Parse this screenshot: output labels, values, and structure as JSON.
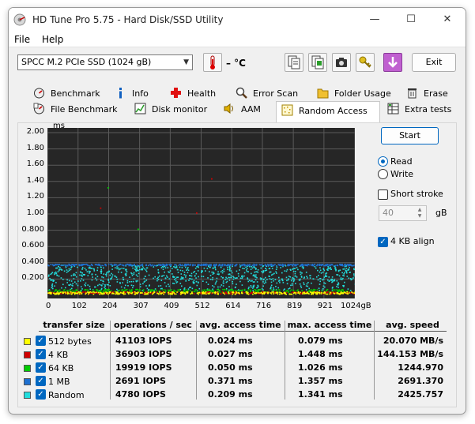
{
  "window": {
    "title": "HD Tune Pro 5.75 - Hard Disk/SSD Utility",
    "minimize": "—",
    "maximize": "☐",
    "close": "✕"
  },
  "menu": [
    "File",
    "Help"
  ],
  "toolbar": {
    "drive": "SPCC M.2 PCIe SSD (1024 gB)",
    "temperature": "– °C",
    "exit": "Exit",
    "icons": [
      "copy-info-icon",
      "copy-screen-icon",
      "screenshot-camera-icon",
      "options-key-icon",
      "save-down-icon"
    ]
  },
  "tabs_row1": [
    {
      "label": "Benchmark",
      "icon": "benchmark-icon"
    },
    {
      "label": "Info",
      "icon": "info-icon"
    },
    {
      "label": "Health",
      "icon": "health-plus-icon"
    },
    {
      "label": "Error Scan",
      "icon": "error-scan-magnifier-icon"
    },
    {
      "label": "Folder Usage",
      "icon": "folder-icon"
    },
    {
      "label": "Erase",
      "icon": "trash-icon"
    }
  ],
  "tabs_row2": [
    {
      "label": "File Benchmark",
      "icon": "file-benchmark-icon"
    },
    {
      "label": "Disk monitor",
      "icon": "disk-monitor-icon"
    },
    {
      "label": "AAM",
      "icon": "speaker-icon"
    },
    {
      "label": "Random Access",
      "icon": "random-access-icon"
    },
    {
      "label": "Extra tests",
      "icon": "extra-tests-icon"
    }
  ],
  "active_tab": "Random Access",
  "chart_data": {
    "type": "scatter",
    "ylabel": "ms",
    "xlabel": "gB",
    "ylim": [
      0,
      2.0
    ],
    "xlim": [
      0,
      1024
    ],
    "y_ticks": [
      "2.00",
      "1.80",
      "1.60",
      "1.40",
      "1.20",
      "1.00",
      "0.800",
      "0.600",
      "0.400",
      "0.200"
    ],
    "x_ticks": [
      "0",
      "102",
      "204",
      "307",
      "409",
      "512",
      "614",
      "716",
      "819",
      "921",
      "1024gB"
    ],
    "grid": true,
    "series": [
      {
        "name": "512 bytes",
        "color": "#ffff00",
        "band": [
          0.01,
          0.04
        ]
      },
      {
        "name": "4 KB",
        "color": "#d00000",
        "band": [
          0.015,
          0.04
        ]
      },
      {
        "name": "64 KB",
        "color": "#00cc00",
        "band": [
          0.03,
          0.07
        ]
      },
      {
        "name": "1 MB",
        "color": "#1e70d0",
        "band": [
          0.36,
          0.38
        ]
      },
      {
        "name": "Random",
        "color": "#22dddd",
        "band": [
          0.05,
          0.37
        ]
      }
    ],
    "outliers": [
      {
        "x": 175,
        "y": 1.08,
        "series": "4 KB"
      },
      {
        "x": 545,
        "y": 1.44,
        "series": "4 KB"
      },
      {
        "x": 495,
        "y": 1.02,
        "series": "4 KB"
      },
      {
        "x": 200,
        "y": 1.33,
        "series": "64 KB"
      },
      {
        "x": 300,
        "y": 0.82,
        "series": "64 KB"
      }
    ]
  },
  "controls": {
    "start": "Start",
    "read": "Read",
    "write": "Write",
    "read_selected": true,
    "short_stroke": "Short stroke",
    "short_stroke_checked": false,
    "stroke_value": "40",
    "stroke_unit": "gB",
    "align": "4 KB align",
    "align_checked": true
  },
  "results": {
    "headers": [
      "transfer size",
      "operations / sec",
      "avg. access time",
      "max. access time",
      "avg. speed"
    ],
    "rows": [
      {
        "name": "512 bytes",
        "color": "#ffff00",
        "ops": "41103 IOPS",
        "avg": "0.024 ms",
        "max": "0.079 ms",
        "speed": "20.070 MB/s"
      },
      {
        "name": "4 KB",
        "color": "#d00000",
        "ops": "36903 IOPS",
        "avg": "0.027 ms",
        "max": "1.448 ms",
        "speed": "144.153 MB/s"
      },
      {
        "name": "64 KB",
        "color": "#00cc00",
        "ops": "19919 IOPS",
        "avg": "0.050 ms",
        "max": "1.026 ms",
        "speed": "1244.970"
      },
      {
        "name": "1 MB",
        "color": "#1e70d0",
        "ops": "2691 IOPS",
        "avg": "0.371 ms",
        "max": "1.357 ms",
        "speed": "2691.370"
      },
      {
        "name": "Random",
        "color": "#22dddd",
        "ops": "4780 IOPS",
        "avg": "0.209 ms",
        "max": "1.341 ms",
        "speed": "2425.757"
      }
    ]
  }
}
